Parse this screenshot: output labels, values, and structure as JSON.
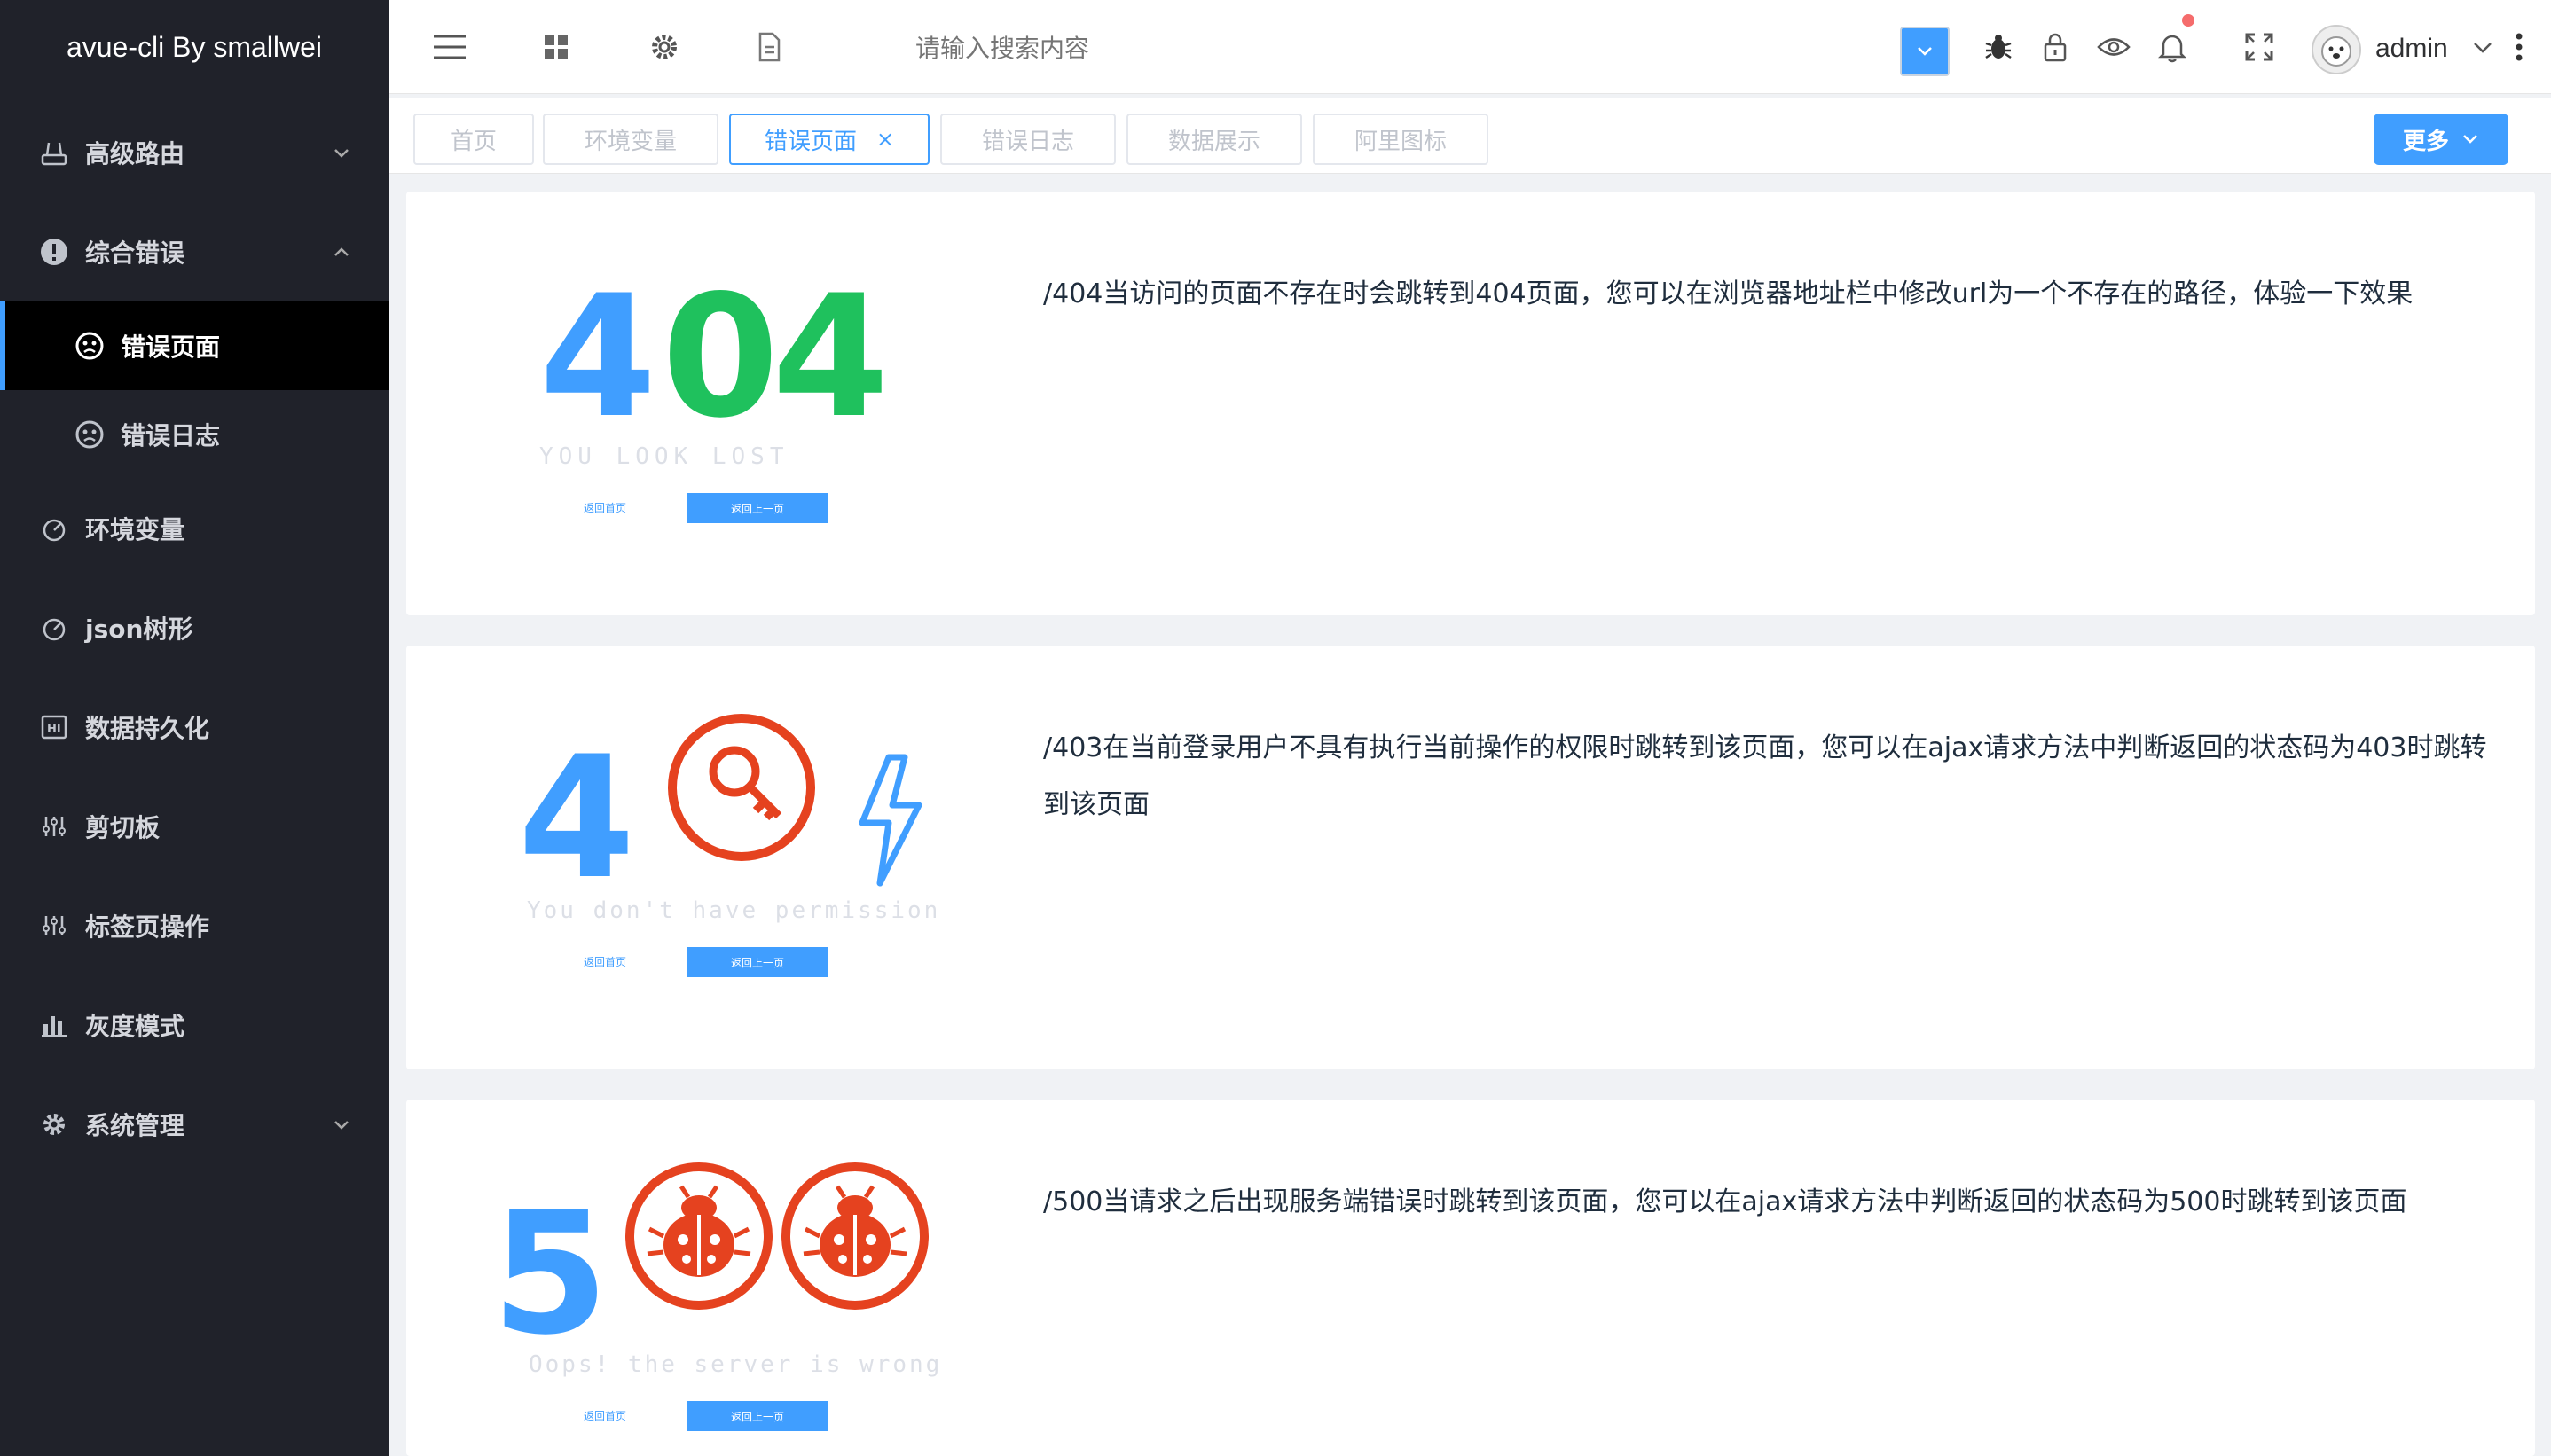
{
  "app": {
    "title": "avue-cli By smallwei"
  },
  "sidebar": {
    "items": [
      {
        "label": "高级路由",
        "icon": "router-icon"
      },
      {
        "label": "综合错误",
        "icon": "error-icon"
      },
      {
        "label": "错误页面",
        "icon": "error-page-icon"
      },
      {
        "label": "错误日志",
        "icon": "error-log-icon"
      },
      {
        "label": "环境变量",
        "icon": "env-icon"
      },
      {
        "label": "json树形",
        "icon": "json-tree-icon"
      },
      {
        "label": "数据持久化",
        "icon": "storage-icon"
      },
      {
        "label": "剪切板",
        "icon": "clipboard-icon"
      },
      {
        "label": "标签页操作",
        "icon": "tabs-icon"
      },
      {
        "label": "灰度模式",
        "icon": "bar-chart-icon"
      },
      {
        "label": "系统管理",
        "icon": "gear-icon"
      }
    ]
  },
  "topbar": {
    "search_placeholder": "请输入搜索内容",
    "user": "admin"
  },
  "tags": {
    "items": [
      {
        "label": "首页"
      },
      {
        "label": "环境变量"
      },
      {
        "label": "错误页面",
        "close": "×"
      },
      {
        "label": "错误日志"
      },
      {
        "label": "数据展示"
      },
      {
        "label": "阿里图标"
      }
    ],
    "more_label": "更多"
  },
  "cards": [
    {
      "number_left": "4",
      "number_right": "04",
      "tagline": "YOU  LOOK  LOST",
      "btn_home": "返回首页",
      "btn_back": "返回上一页",
      "desc": "/404当访问的页面不存在时会跳转到404页面，您可以在浏览器地址栏中修改url为一个不存在的路径，体验一下效果"
    },
    {
      "number_left": "4",
      "tagline": "You don't have permission",
      "btn_home": "返回首页",
      "btn_back": "返回上一页",
      "desc": "/403在当前登录用户不具有执行当前操作的权限时跳转到该页面，您可以在ajax请求方法中判断返回的状态码为403时跳转到该页面"
    },
    {
      "number_left": "5",
      "tagline": "Oops! the server is wrong",
      "btn_home": "返回首页",
      "btn_back": "返回上一页",
      "desc": "/500当请求之后出现服务端错误时跳转到该页面，您可以在ajax请求方法中判断返回的状态码为500时跳转到该页面"
    }
  ],
  "colors": {
    "accent": "#409eff",
    "green": "#1fc15d",
    "red": "#e5421f",
    "sidebar_bg": "#20222a"
  }
}
